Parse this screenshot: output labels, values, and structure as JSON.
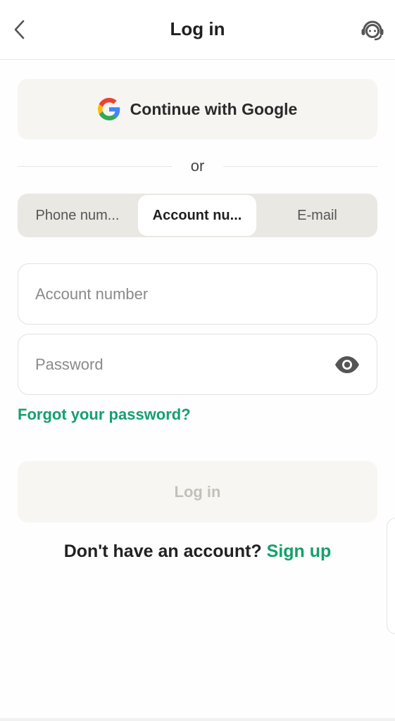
{
  "header": {
    "title": "Log in",
    "back_icon": "chevron-left-icon",
    "support_icon": "headset-support-icon"
  },
  "google": {
    "label": "Continue with Google",
    "icon": "google-logo-icon"
  },
  "divider": {
    "text": "or"
  },
  "tabs": [
    {
      "label": "Phone num...",
      "selected": false
    },
    {
      "label": "Account nu...",
      "selected": true
    },
    {
      "label": "E-mail",
      "selected": false
    }
  ],
  "form": {
    "account_placeholder": "Account number",
    "account_value": "",
    "password_placeholder": "Password",
    "password_value": "",
    "eye_icon": "eye-icon",
    "forgot_label": "Forgot your password?"
  },
  "login": {
    "label": "Log in"
  },
  "signup": {
    "prompt": "Don't have an account?",
    "link": "Sign up"
  },
  "colors": {
    "accent": "#15a06e",
    "tab_bg": "#e9e8e3",
    "disabled_text": "#c4c0b9"
  }
}
